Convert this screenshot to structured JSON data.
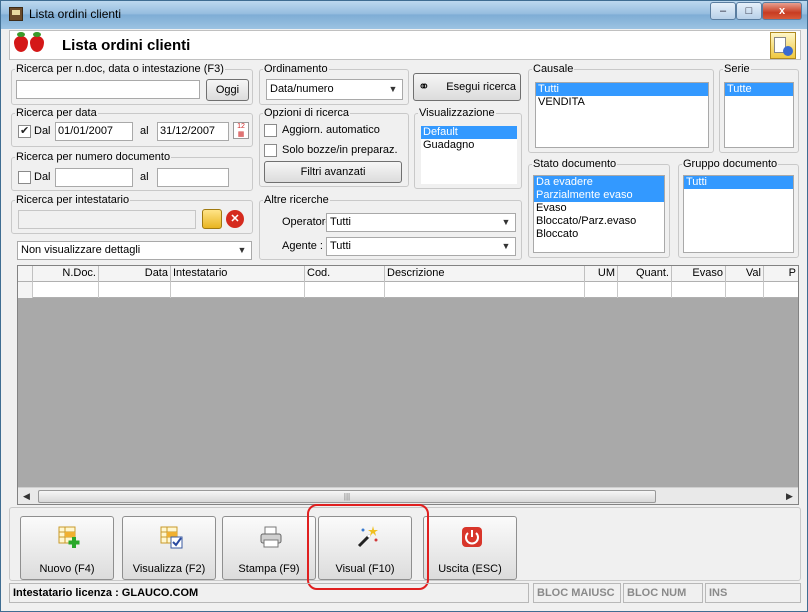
{
  "window": {
    "title": "Lista ordini clienti",
    "controls": {
      "minimize": "–",
      "maximize": "□",
      "close": "x"
    }
  },
  "header": {
    "title": "Lista ordini clienti"
  },
  "search_text": {
    "legend": "Ricerca per n.doc, data o intestazione (F3)",
    "value": "",
    "today_button": "Oggi"
  },
  "ordering": {
    "legend": "Ordinamento",
    "selected": "Data/numero"
  },
  "execute_button": "Esegui ricerca",
  "date_search": {
    "legend": "Ricerca per data",
    "from_checked": true,
    "from_label": "Dal",
    "from_value": "01/01/2007",
    "to_label": "al",
    "to_value": "31/12/2007"
  },
  "number_search": {
    "legend": "Ricerca per numero documento",
    "from_checked": false,
    "from_label": "Dal",
    "from_value": "",
    "to_label": "al",
    "to_value": ""
  },
  "holder_search": {
    "legend": "Ricerca per intestatario",
    "value": ""
  },
  "details_select": {
    "selected": "Non visualizzare dettagli"
  },
  "search_options": {
    "legend": "Opzioni di ricerca",
    "auto_update": {
      "label": "Aggiorn. automatico",
      "checked": false
    },
    "drafts_only": {
      "label": "Solo bozze/in preparaz.",
      "checked": false
    },
    "advanced_button": "Filtri avanzati"
  },
  "view": {
    "legend": "Visualizzazione",
    "items": [
      "Default",
      "Guadagno"
    ],
    "selected_index": 0
  },
  "other_search": {
    "legend": "Altre ricerche",
    "operator_label": "Operatore :",
    "operator_value": "Tutti",
    "agent_label": "Agente :",
    "agent_value": "Tutti"
  },
  "causale": {
    "legend": "Causale",
    "items": [
      "Tutti",
      "VENDITA"
    ],
    "selected": [
      0
    ]
  },
  "serie": {
    "legend": "Serie",
    "items": [
      "Tutte"
    ],
    "selected": [
      0
    ]
  },
  "doc_state": {
    "legend": "Stato documento",
    "items": [
      "Da evadere",
      "Parzialmente evaso",
      "Evaso",
      "Bloccato/Parz.evaso",
      "Bloccato"
    ],
    "selected": [
      0,
      1
    ]
  },
  "doc_group": {
    "legend": "Gruppo documento",
    "items": [
      "Tutti"
    ],
    "selected": [
      0
    ]
  },
  "grid": {
    "columns": [
      "",
      "N.Doc.",
      "Data",
      "Intestatario",
      "Cod.",
      "Descrizione",
      "UM",
      "Quant.",
      "Evaso",
      "Val",
      "P"
    ]
  },
  "toolbar": {
    "new": "Nuovo (F4)",
    "view": "Visualizza (F2)",
    "print": "Stampa (F9)",
    "visual": "Visual (F10)",
    "exit": "Uscita (ESC)"
  },
  "status": {
    "license": "Intestatario licenza : GLAUCO.COM",
    "caps": "BLOC MAIUSC",
    "num": "BLOC NUM",
    "ins": "INS"
  },
  "colors": {
    "selection": "#3399ff",
    "highlight": "#e02020",
    "grid_background": "#a9a9a9"
  }
}
